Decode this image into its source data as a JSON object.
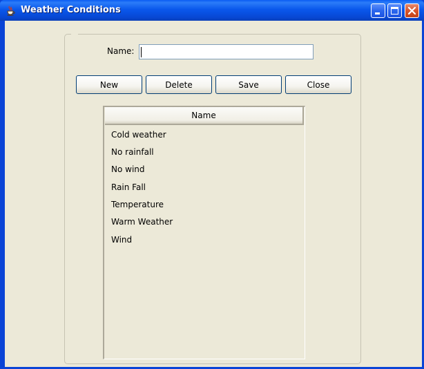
{
  "window": {
    "title": "Weather Conditions",
    "app_icon": "java-cup-icon",
    "controls": {
      "minimize_icon": "minimize-icon",
      "maximize_icon": "maximize-icon",
      "close_icon": "close-icon"
    }
  },
  "form": {
    "name_label": "Name:",
    "name_value": "",
    "name_placeholder": ""
  },
  "toolbar": {
    "new_label": "New",
    "delete_label": "Delete",
    "save_label": "Save",
    "close_label": "Close"
  },
  "list": {
    "column_header": "Name",
    "items": [
      "Cold weather",
      "No rainfall",
      "No wind",
      "Rain Fall",
      "Temperature",
      "Warm Weather",
      "Wind"
    ]
  },
  "colors": {
    "titlebar": "#0a58ec",
    "window_bg": "#ece9d8",
    "close_button": "#d9552b",
    "button_border": "#003c74"
  }
}
